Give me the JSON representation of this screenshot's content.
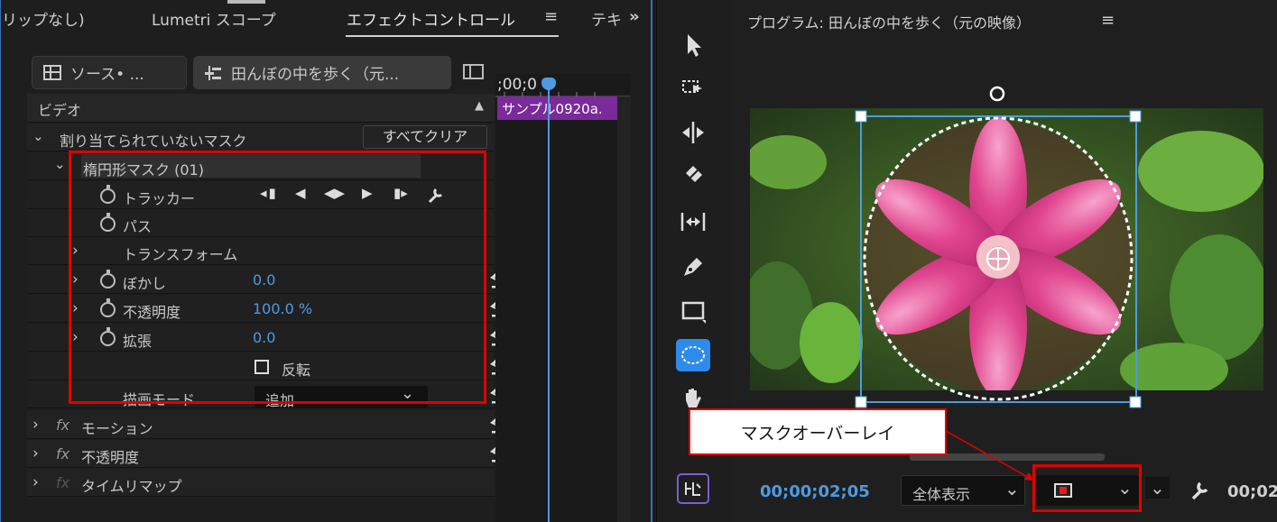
{
  "effect_panel": {
    "tabs": [
      "リップなし)",
      "Lumetri スコープ",
      "エフェクトコントロール",
      "≡",
      "テキ",
      "»"
    ],
    "source_button": "ソース• ...",
    "clip_button": "田んぼの中を歩く（元...",
    "timecode_fragment": ";00;0",
    "clip_name": "サンプル0920a.",
    "section_video": "ビデオ",
    "unassigned_mask": "割り当てられていないマスク",
    "clear_all": "すべてクリア",
    "ellipse_mask": "楕円形マスク (01)",
    "tracker_label": "トラッカー",
    "path_label": "パス",
    "transform_label": "トランスフォーム",
    "feather_label": "ぼかし",
    "feather_value": "0.0",
    "opacity_label": "不透明度",
    "opacity_value": "100.0 %",
    "expansion_label": "拡張",
    "expansion_value": "0.0",
    "invert_label": "反転",
    "blend_mode_label": "描画モード",
    "blend_mode_value": "追加",
    "motion_label": "モーション",
    "opacity_fx_label": "不透明度",
    "time_remap_label": "タイムリマップ",
    "fx_symbol": "fx"
  },
  "monitor": {
    "title": "プログラム: 田んぼの中を歩く（元の映像）",
    "menu": "≡",
    "timecode": "00;00;02;05",
    "zoom": "全体表示",
    "timecode_right": "00;02"
  },
  "callout_text": "マスクオーバーレイ",
  "colors": {
    "accent_blue": "#4e9be0",
    "highlight_red": "#e00000",
    "clip_purple": "#7a2a9a",
    "mask_tool_blue": "#2d8ceb"
  }
}
